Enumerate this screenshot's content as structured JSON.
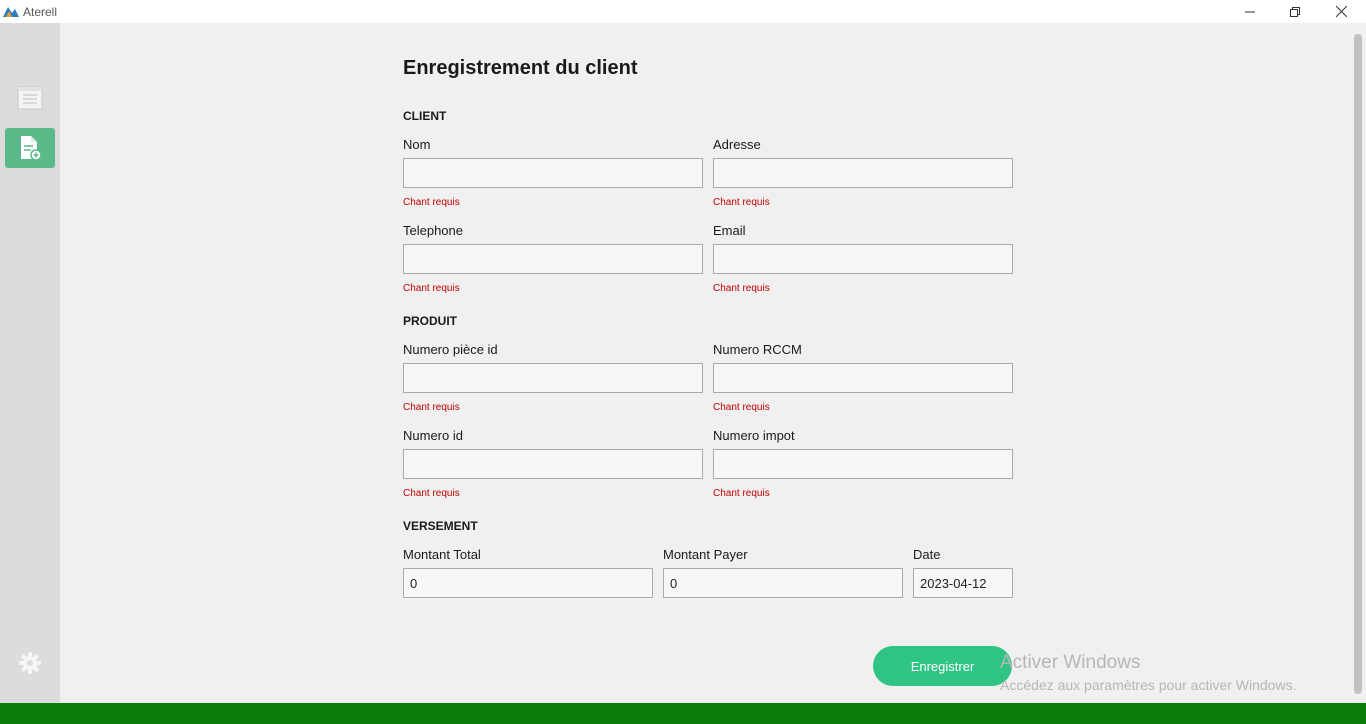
{
  "window": {
    "title": "Aterell",
    "minimize_glyph": "—",
    "maximize_glyph": "❐",
    "close_glyph": "✕"
  },
  "sidebar": {
    "items": [
      {
        "icon": "list-icon",
        "active": false
      },
      {
        "icon": "add-document-icon",
        "active": true
      }
    ],
    "settings_icon": "gear-icon",
    "active_color": "#5cb98a"
  },
  "form": {
    "title": "Enregistrement du client",
    "sections": {
      "client": "CLIENT",
      "produit": "PRODUIT",
      "versement": "VERSEMENT"
    },
    "fields": {
      "nom": {
        "label": "Nom",
        "value": "",
        "error": "Chant requis"
      },
      "adresse": {
        "label": "Adresse",
        "value": "",
        "error": "Chant requis"
      },
      "telephone": {
        "label": "Telephone",
        "value": "",
        "error": "Chant requis"
      },
      "email": {
        "label": "Email",
        "value": "",
        "error": "Chant requis"
      },
      "numero_piece_id": {
        "label": "Numero pièce id",
        "value": "",
        "error": "Chant requis"
      },
      "numero_rccm": {
        "label": "Numero RCCM",
        "value": "",
        "error": "Chant requis"
      },
      "numero_id": {
        "label": "Numero id",
        "value": "",
        "error": "Chant requis"
      },
      "numero_impot": {
        "label": "Numero impot",
        "value": "",
        "error": "Chant requis"
      },
      "montant_total": {
        "label": "Montant Total",
        "value": "0"
      },
      "montant_payer": {
        "label": "Montant Payer",
        "value": "0"
      },
      "date": {
        "label": "Date",
        "value": "2023-04-12"
      }
    },
    "submit_label": "Enregistrer"
  },
  "watermark": {
    "title": "Activer Windows",
    "subtitle": "Accédez aux paramètres pour activer Windows."
  },
  "colors": {
    "accent": "#2fc484",
    "error": "#c00000",
    "bottom_bar": "#0a7c0a"
  }
}
